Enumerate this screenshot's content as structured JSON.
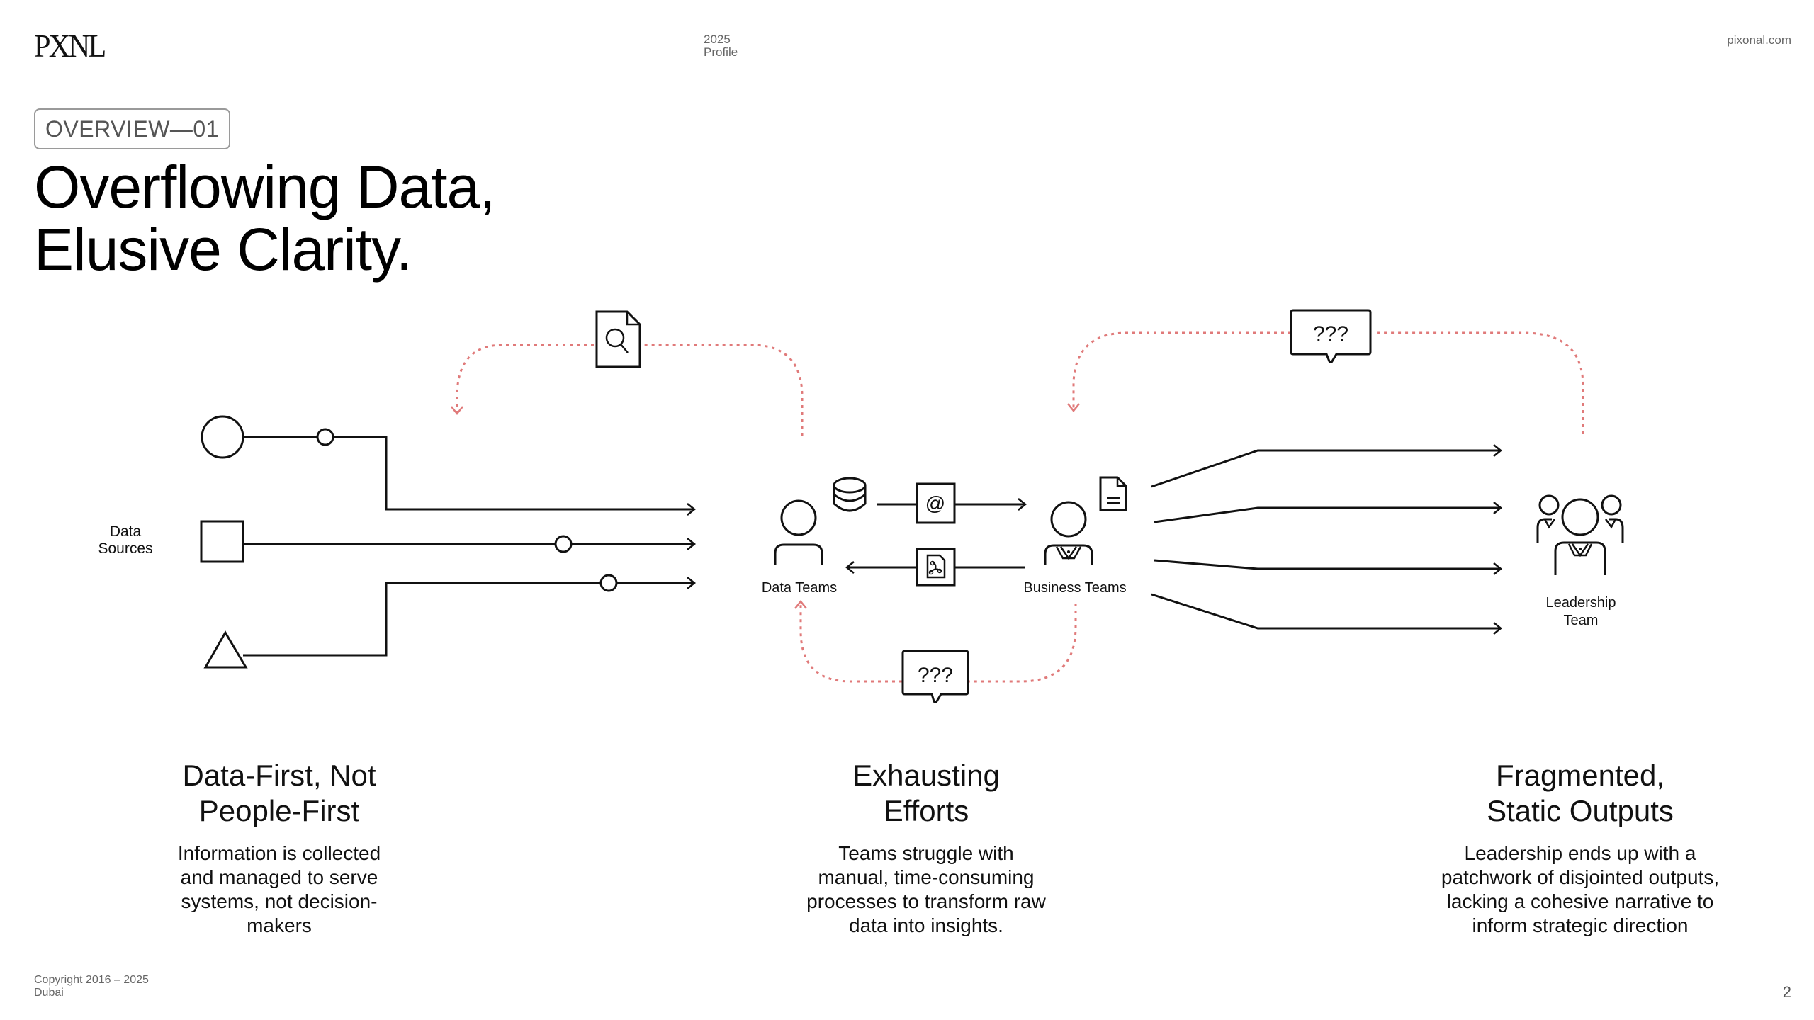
{
  "header": {
    "logo": "PXNL",
    "year": "2025",
    "doc_type": "Profile",
    "site_link": "pixonal.com"
  },
  "section_tag": "OVERVIEW—01",
  "title": {
    "line1": "Overflowing Data,",
    "line2": "Elusive Clarity."
  },
  "diagram": {
    "data_sources_label": [
      "Data",
      "Sources"
    ],
    "data_sources_shapes": [
      "circle",
      "square",
      "triangle"
    ],
    "data_teams_label": "Data Teams",
    "business_teams_label": "Business Teams",
    "leadership_label": [
      "Leadership",
      "Team"
    ],
    "query_bubble_text": "???",
    "icons": {
      "document_search": "document-search-icon",
      "database": "database-icon",
      "email": "at-sign-icon",
      "pdf_file": "pdf-file-icon",
      "document": "document-icon",
      "person": "person-icon",
      "business_person": "business-person-icon",
      "leadership_group": "group-icon"
    },
    "colors": {
      "line": "#111111",
      "feedback_loop": "#e07a7a"
    }
  },
  "columns": [
    {
      "heading": [
        "Data-First, Not",
        "People-First"
      ],
      "body": [
        "Information is collected",
        "and managed to serve",
        "systems, not decision-",
        "makers"
      ]
    },
    {
      "heading": [
        "Exhausting",
        "Efforts"
      ],
      "body": [
        "Teams struggle with",
        "manual, time-consuming",
        "processes to transform raw",
        "data into insights."
      ]
    },
    {
      "heading": [
        "Fragmented,",
        "Static Outputs"
      ],
      "body": [
        "Leadership ends up with a",
        "patchwork of disjointed outputs,",
        "lacking a cohesive narrative to",
        "inform strategic direction"
      ]
    }
  ],
  "footer": {
    "copyright": "Copyright 2016 – 2025",
    "location": "Dubai",
    "page_number": "2"
  }
}
